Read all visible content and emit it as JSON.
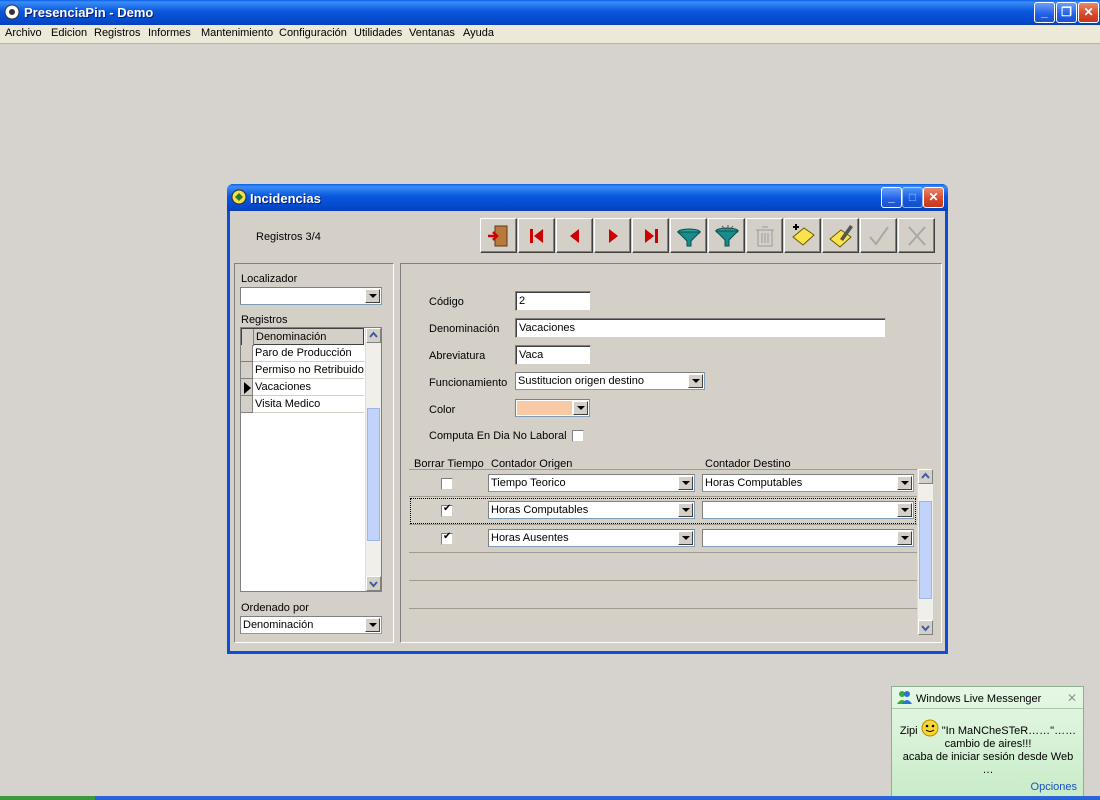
{
  "window": {
    "title": "PresenciaPin - Demo"
  },
  "menu": [
    "Archivo",
    "Edicion",
    "Registros",
    "Informes",
    "Mantenimiento",
    "Configuración",
    "Utilidades",
    "Ventanas",
    "Ayuda"
  ],
  "dialog": {
    "title": "Incidencias",
    "record_counter": "Registros 3/4",
    "toolbar": [
      "exit-door-icon",
      "first-record-icon",
      "prev-record-icon",
      "next-record-icon",
      "last-record-icon",
      "filter-icon",
      "clear-filter-icon",
      "delete-icon",
      "new-record-icon",
      "edit-record-icon",
      "accept-icon",
      "cancel-icon"
    ],
    "left": {
      "locator_label": "Localizador",
      "locator_value": "",
      "records_label": "Registros",
      "column_header": "Denominación",
      "rows": [
        "Paro de Producción",
        "Permiso no Retribuido",
        "Vacaciones",
        "Visita Medico"
      ],
      "current_row_index": 2,
      "order_label": "Ordenado por",
      "order_value": "Denominación"
    },
    "form": {
      "codigo_label": "Código",
      "codigo_value": "2",
      "denominacion_label": "Denominación",
      "denominacion_value": "Vacaciones",
      "abreviatura_label": "Abreviatura",
      "abreviatura_value": "Vaca",
      "funcionamiento_label": "Funcionamiento",
      "funcionamiento_value": "Sustitucion origen destino",
      "color_label": "Color",
      "color_value": "#f9c9a6",
      "computa_label": "Computa En Dia No Laboral",
      "computa_checked": false
    },
    "counters": {
      "headers": {
        "borrar": "Borrar Tiempo",
        "origen": "Contador Origen",
        "destino": "Contador Destino"
      },
      "rows": [
        {
          "borrar": false,
          "origen": "Tiempo Teorico",
          "destino": "Horas Computables"
        },
        {
          "borrar": true,
          "origen": "Horas Computables",
          "destino": ""
        },
        {
          "borrar": true,
          "origen": "Horas Ausentes",
          "destino": ""
        }
      ]
    }
  },
  "notification": {
    "app": "Windows Live Messenger",
    "line1": "Zipi",
    "line2": "\"In MaNCheSTeR……\"……cambio de aires!!!",
    "line3": "acaba de iniciar sesión desde Web …",
    "options": "Opciones"
  },
  "colors": {
    "title_blue": "#0a58dd",
    "face": "#d4d0c8",
    "color_swatch": "#f9c9a6"
  }
}
